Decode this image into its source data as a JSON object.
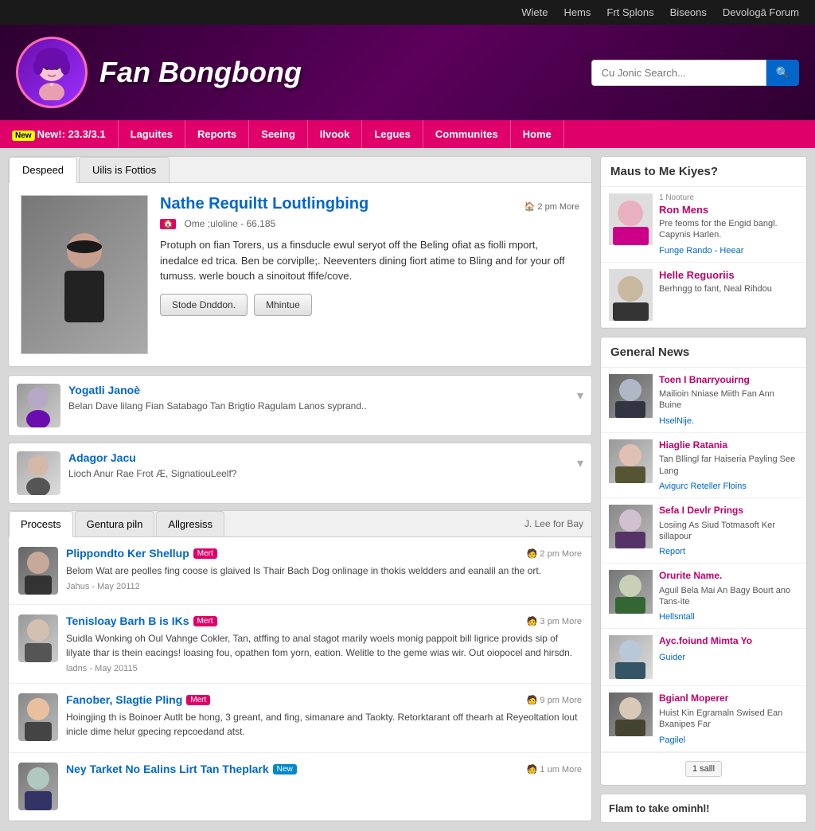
{
  "topnav": {
    "items": [
      "Wiete",
      "Hems",
      "Frt Splons",
      "Biseons",
      "Devologā Forum"
    ]
  },
  "header": {
    "title": "Fan Bongbong",
    "search_placeholder": "Cu Jonic Search..."
  },
  "mainnav": {
    "new_label": "New!: 23.3/3.1",
    "items": [
      "Laguites",
      "Reports",
      "Seeing",
      "Ilvook",
      "Legues",
      "Communites",
      "Home"
    ]
  },
  "profile": {
    "tabs": [
      "Despeed",
      "Uilis is Fottios"
    ],
    "active_tab": 0,
    "name": "Nathe Requiltt Loutlingbing",
    "meta": "Ome ;uloline - 66.185",
    "time": "🏠 2 pm More",
    "description": "Protuph on fian Torers, us a finsducle ewul seryot off the Beling ofiat as fiolli mport, inedalce ed trica. Ben be corviplle;. Neeventers dining fiort atime to Bling and for your off tumuss. werle bouch a sinoitout ffife/cove.",
    "btn1": "Stode Dnddon.",
    "btn2": "Mhintue"
  },
  "user_list": [
    {
      "name": "Yogatli Janoè",
      "text": "Belan Dave lilang Fian Satabago Tan Brigtio Ragulam Lanos syprand.."
    },
    {
      "name": "Adagor Jacu",
      "text": "Lioch Anur Rae Frot Æ, SignatiouLeelf?"
    }
  ],
  "posts": {
    "tabs": [
      "Procests",
      "Gentura piln",
      "Allgresiss"
    ],
    "label": "J. Lee for Bay",
    "items": [
      {
        "name": "Plippondto Ker Shellup",
        "badge": "Mert",
        "time": "🧑 2 pm More",
        "text": "Belom Wat are peolles fing coose is glaived Is Thair Bach Dog onlinage in thokis weldders and eanalil an the ort.",
        "meta": "Jahus - May 20112"
      },
      {
        "name": "Tenisloay Barh B is IKs",
        "badge": "Mert",
        "time": "🧑 3 pm More",
        "text": "Suidla Wonking oh Oul Vahnge Cokler, Tan, atffing to anal stagot marily woels monig pappoit bill ligrice provids sip of lilyate thar is thein eacings! loasing fou, opathen fom yorn, eation. Welitle to the geme wias wir. Out oiopocel and hirsdn.",
        "meta": "ladns - May 20115"
      },
      {
        "name": "Fanober, Slagtie Pling",
        "badge": "Mert",
        "time": "🧑 9 pm More",
        "text": "Hoingjing th is Boinoer Autlt be hong, 3 greant, and fing, simanare and Taokty. Retorktarant off thearh at Reyeoltation lout inicle dime helur gpecing repcoedand atst.",
        "meta": ""
      },
      {
        "name": "Ney Tarket No Ealins Lirt Tan Theplark",
        "badge": "New",
        "time": "🧑 1 um More",
        "text": "",
        "meta": ""
      }
    ]
  },
  "sidebar": {
    "maus_title": "Maus to Me Kiyes?",
    "maus_users": [
      {
        "label": "1 Nooture",
        "name": "Ron Mens",
        "desc": "Pre feoms for the Engid bangl. Capynis Harlen.",
        "link": "Funge Rando - Heear"
      },
      {
        "label": "",
        "name": "Helle Reguoriis",
        "desc": "Berhngg to fant, Neal Rihdou",
        "link": ""
      }
    ],
    "news_title": "General News",
    "news_items": [
      {
        "title": "Toen I Bnarryouirng",
        "desc": "Mailioin Nniase Miith Fan Ann Buine",
        "link": "HselNije."
      },
      {
        "title": "Hiaglie Ratania",
        "desc": "Tan Bllingl far Haiseria Payling See Lang",
        "link": "Avigurc Reteller Floins"
      },
      {
        "title": "Sefa I Devlr Prings",
        "desc": "Losiing As Siud Totmasoft Ker sillapour",
        "link": "Report"
      },
      {
        "title": "Orurite Name.",
        "desc": "Aguil Bela Mai An Bagy Bourt ano Tans-ite",
        "link": "Hellsntall"
      },
      {
        "title": "Ayc.foiund Mimta Yo",
        "desc": "",
        "link": "Guider"
      },
      {
        "title": "Bgianl Moperer",
        "desc": "Huist Kin Egramaln Swised Ean Bxanipes Far",
        "link": "Pagilel"
      }
    ],
    "footer_title": "Flam to take ominhl!",
    "pagination": "1 salll"
  }
}
